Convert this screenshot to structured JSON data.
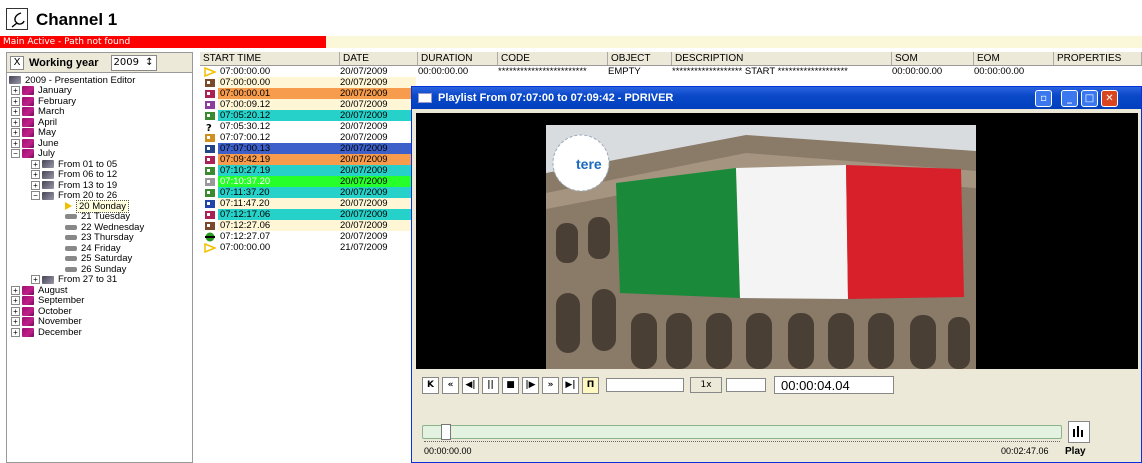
{
  "app": {
    "title": "Channel 1",
    "status": "Main Active - Path not found"
  },
  "year_bar": {
    "label": "Working year",
    "year": "2009",
    "close_glyph": "X",
    "spin_glyph": "↕"
  },
  "tree": {
    "root": "2009 - Presentation Editor",
    "months": [
      "January",
      "February",
      "March",
      "April",
      "May",
      "June",
      "July",
      "August",
      "September",
      "October",
      "November",
      "December"
    ],
    "july_weeks": [
      "From 01 to 05",
      "From 06 to 12",
      "From 13 to 19",
      "From 20 to 26",
      "From 27 to 31"
    ],
    "days": [
      "20 Monday",
      "21 Tuesday",
      "22 Wednesday",
      "23 Thursday",
      "24 Friday",
      "25 Saturday",
      "26 Sunday"
    ]
  },
  "grid": {
    "columns": [
      "START TIME",
      "DATE",
      "DURATION",
      "CODE",
      "OBJECT",
      "DESCRIPTION",
      "SOM",
      "EOM",
      "PROPERTIES"
    ],
    "rows": [
      {
        "time": "07:00:00.00",
        "date": "20/07/2009",
        "dur": "00:00:00.00",
        "code": "************************",
        "obj": "EMPTY",
        "desc": "******************* START *******************",
        "som": "00:00:00.00",
        "eom": "00:00:00.00",
        "bg": "#ffffff",
        "icon": "start-flag-icon",
        "ic": "#f0c000"
      },
      {
        "time": "07:00:00.00",
        "date": "20/07/2009",
        "dur": "",
        "code": "",
        "obj": "",
        "desc": "",
        "som": "",
        "eom": "",
        "bg": "#fff6d5",
        "icon": "clip-icon",
        "ic": "#7b4a2a"
      },
      {
        "time": "07:00:00.01",
        "date": "20/07/2009",
        "dur": "",
        "code": "",
        "obj": "",
        "desc": "",
        "som": "",
        "eom": "",
        "bg": "#f79b4c",
        "icon": "clip-icon",
        "ic": "#aa2255"
      },
      {
        "time": "07:00:09.12",
        "date": "20/07/2009",
        "dur": "",
        "code": "",
        "obj": "",
        "desc": "",
        "som": "",
        "eom": "",
        "bg": "#fff6d5",
        "icon": "clip-icon",
        "ic": "#8a3fa0"
      },
      {
        "time": "07:05:20.12",
        "date": "20/07/2009",
        "dur": "",
        "code": "",
        "obj": "",
        "desc": "",
        "som": "",
        "eom": "",
        "bg": "#25d1c8",
        "icon": "clip-icon",
        "ic": "#3a8a30"
      },
      {
        "time": "07:05:30.12",
        "date": "20/07/2009",
        "dur": "",
        "code": "",
        "obj": "",
        "desc": "",
        "som": "",
        "eom": "",
        "bg": "#ffffff",
        "icon": "question-icon",
        "ic": "#333333"
      },
      {
        "time": "07:07:00.12",
        "date": "20/07/2009",
        "dur": "",
        "code": "",
        "obj": "",
        "desc": "",
        "som": "",
        "eom": "",
        "bg": "#ffffff",
        "icon": "clip-icon",
        "ic": "#d09020"
      },
      {
        "time": "07:07:00.13",
        "date": "20/07/2009",
        "dur": "",
        "code": "",
        "obj": "",
        "desc": "",
        "som": "",
        "eom": "",
        "bg": "#3c5fc9",
        "icon": "clip-icon",
        "ic": "#224488"
      },
      {
        "time": "07:09:42.19",
        "date": "20/07/2009",
        "dur": "",
        "code": "",
        "obj": "",
        "desc": "",
        "som": "",
        "eom": "",
        "bg": "#f79b4c",
        "icon": "clip-icon",
        "ic": "#aa2255"
      },
      {
        "time": "07:10:27.19",
        "date": "20/07/2009",
        "dur": "",
        "code": "",
        "obj": "",
        "desc": "",
        "som": "",
        "eom": "",
        "bg": "#25d1c8",
        "icon": "clip-icon",
        "ic": "#3a8a30"
      },
      {
        "time": "07:10:37.20",
        "date": "20/07/2009",
        "dur": "",
        "code": "",
        "obj": "",
        "desc": "",
        "som": "",
        "eom": "",
        "bg": "#27ff2a",
        "icon": "clip-icon",
        "ic": "#999999",
        "white": true
      },
      {
        "time": "07:11:37.20",
        "date": "20/07/2009",
        "dur": "",
        "code": "",
        "obj": "",
        "desc": "",
        "som": "",
        "eom": "",
        "bg": "#25d1c8",
        "icon": "clip-icon",
        "ic": "#3a8a30"
      },
      {
        "time": "07:11:47.20",
        "date": "20/07/2009",
        "dur": "",
        "code": "",
        "obj": "",
        "desc": "",
        "som": "",
        "eom": "",
        "bg": "#fff6d5",
        "icon": "clip-icon",
        "ic": "#2244aa"
      },
      {
        "time": "07:12:17.06",
        "date": "20/07/2009",
        "dur": "",
        "code": "",
        "obj": "",
        "desc": "",
        "som": "",
        "eom": "",
        "bg": "#25d1c8",
        "icon": "clip-icon",
        "ic": "#aa2255"
      },
      {
        "time": "07:12:27.06",
        "date": "20/07/2009",
        "dur": "",
        "code": "",
        "obj": "",
        "desc": "",
        "som": "",
        "eom": "",
        "bg": "#fff6d5",
        "icon": "clip-icon",
        "ic": "#7b4a2a"
      },
      {
        "time": "07:12:27.07",
        "date": "20/07/2009",
        "dur": "",
        "code": "",
        "obj": "",
        "desc": "",
        "som": "",
        "eom": "",
        "bg": "#ffffff",
        "icon": "end-marker-icon",
        "ic": "#2a9a20"
      },
      {
        "time": "07:00:00.00",
        "date": "21/07/2009",
        "dur": "",
        "code": "",
        "obj": "",
        "desc": "",
        "som": "",
        "eom": "",
        "bg": "#ffffff",
        "icon": "start-flag-icon",
        "ic": "#f0c000"
      }
    ]
  },
  "player": {
    "title": "Playlist From 07:07:00 to 07:09:42 - PDRIVER",
    "logo_text": "tere",
    "speed": "1x",
    "timecode": "00:00:04.04",
    "pos_start": "00:00:00.00",
    "pos_end": "00:02:47.06",
    "play_label": "Play",
    "progress": 0.02,
    "controls": [
      "K",
      "«",
      "◀|",
      "||",
      "■",
      "|▶",
      "»",
      "▶|",
      "Π"
    ]
  },
  "colors": {
    "status_red": "#ff0000",
    "title_blue": "#0a48c8",
    "flag_green": "#1a8a3a",
    "flag_red": "#d8202a"
  }
}
